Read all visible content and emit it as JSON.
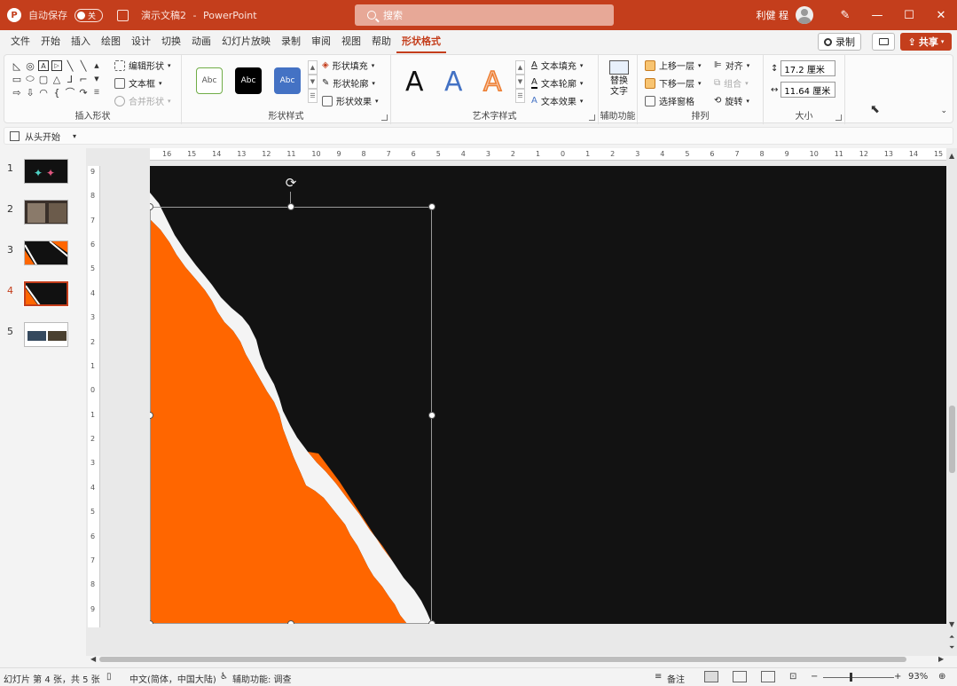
{
  "titlebar": {
    "logo": "P",
    "autosave_label": "自动保存",
    "autosave_state": "关",
    "doc_name": "演示文稿2",
    "separator": "-",
    "app_name": "PowerPoint",
    "search_placeholder": "搜索",
    "user_name": "利健 程",
    "accent_color": "#c43e1c"
  },
  "tabs": [
    "文件",
    "开始",
    "插入",
    "绘图",
    "设计",
    "切换",
    "动画",
    "幻灯片放映",
    "录制",
    "审阅",
    "视图",
    "帮助",
    "形状格式"
  ],
  "active_tab": "形状格式",
  "header_actions": {
    "record": "录制",
    "share": "共享"
  },
  "ribbon": {
    "insert_shapes": {
      "label": "插入形状",
      "edit_shape": "编辑形状",
      "text_box": "文本框",
      "merge_shapes": "合并形状"
    },
    "shape_styles": {
      "label": "形状样式",
      "swatches": [
        "Abc",
        "Abc",
        "Abc"
      ],
      "fill": "形状填充",
      "outline": "形状轮廓",
      "effects": "形状效果"
    },
    "wordart_styles": {
      "label": "艺术字样式",
      "letters": [
        "A",
        "A",
        "A"
      ],
      "text_fill": "文本填充",
      "text_outline": "文本轮廓",
      "text_effects": "文本效果"
    },
    "accessibility": {
      "label": "辅助功能",
      "alt_text_line1": "替换",
      "alt_text_line2": "文字"
    },
    "arrange": {
      "label": "排列",
      "bring_forward": "上移一层",
      "send_backward": "下移一层",
      "selection_pane": "选择窗格",
      "align": "对齐",
      "group": "组合",
      "rotate": "旋转"
    },
    "size": {
      "label": "大小",
      "height": "17.2 厘米",
      "width": "11.64 厘米"
    }
  },
  "qat": {
    "from_beginning": "从头开始"
  },
  "slides": [
    {
      "num": "1"
    },
    {
      "num": "2"
    },
    {
      "num": "3"
    },
    {
      "num": "4",
      "active": true
    },
    {
      "num": "5"
    }
  ],
  "ruler": {
    "h_ticks": [
      "16",
      "15",
      "14",
      "13",
      "12",
      "11",
      "10",
      "9",
      "8",
      "7",
      "6",
      "5",
      "4",
      "3",
      "2",
      "1",
      "0",
      "1",
      "2",
      "3",
      "4",
      "5",
      "6",
      "7",
      "8",
      "9",
      "10",
      "11",
      "12",
      "13",
      "14",
      "15"
    ],
    "v_ticks": [
      "9",
      "8",
      "7",
      "6",
      "5",
      "4",
      "3",
      "2",
      "1",
      "0",
      "1",
      "2",
      "3",
      "4",
      "5",
      "6",
      "7",
      "8",
      "9"
    ]
  },
  "slide_colors": {
    "background": "#121212",
    "orange": "#ff6600",
    "paper": "#f4f4f4"
  },
  "statusbar": {
    "slide_info": "幻灯片 第 4 张，共 5 张",
    "language": "中文(简体，中国大陆)",
    "accessibility": "辅助功能: 调查",
    "notes": "备注",
    "zoom": "93%"
  }
}
